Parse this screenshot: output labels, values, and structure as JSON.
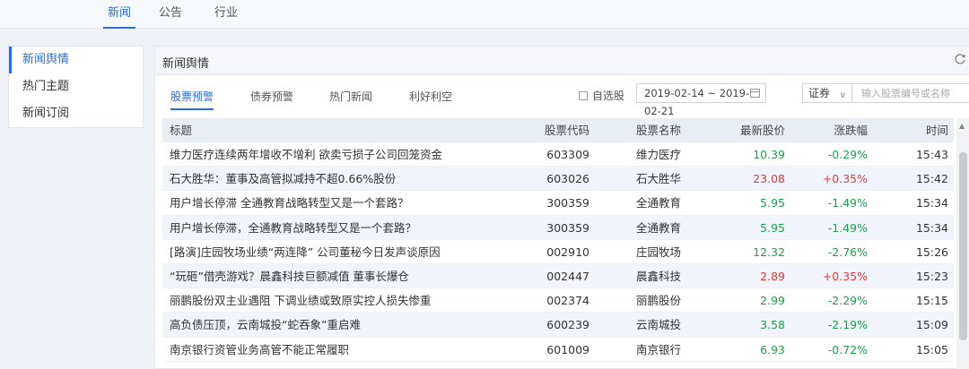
{
  "topnav": {
    "tabs": [
      {
        "label": "新闻",
        "active": true
      },
      {
        "label": "公告",
        "active": false
      },
      {
        "label": "行业",
        "active": false
      }
    ]
  },
  "sidebar": {
    "items": [
      {
        "label": "新闻舆情",
        "active": true
      },
      {
        "label": "热门主题",
        "active": false
      },
      {
        "label": "新闻订阅",
        "active": false
      }
    ]
  },
  "panel": {
    "title": "新闻舆情",
    "refresh_icon": "refresh-icon",
    "subtabs": [
      {
        "label": "股票预警",
        "active": true
      },
      {
        "label": "债券预警",
        "active": false
      },
      {
        "label": "热门新闻",
        "active": false
      },
      {
        "label": "利好利空",
        "active": false
      }
    ],
    "filters": {
      "watchlist_label": "自选股",
      "date_range": "2019-02-14 ~ 2019-02-21",
      "type_value": "证券",
      "code_placeholder": "输入股票编号或名称"
    }
  },
  "table": {
    "headers": {
      "title": "标题",
      "code": "股票代码",
      "name": "股票名称",
      "price": "最新股价",
      "change": "涨跌幅",
      "time": "时间"
    },
    "rows": [
      {
        "title": "维力医疗连续两年增收不增利 欲卖亏损子公司回笼资金",
        "code": "603309",
        "name": "维力医疗",
        "price": "10.39",
        "change": "-0.29%",
        "time": "15:43",
        "trend": "down"
      },
      {
        "title": "石大胜华：董事及高管拟减持不超0.66%股份",
        "code": "603026",
        "name": "石大胜华",
        "price": "23.08",
        "change": "+0.35%",
        "time": "15:42",
        "trend": "up"
      },
      {
        "title": "用户增长停滞 全通教育战略转型又是一个套路？",
        "code": "300359",
        "name": "全通教育",
        "price": "5.95",
        "change": "-1.49%",
        "time": "15:34",
        "trend": "down"
      },
      {
        "title": "用户增长停滞，全通教育战略转型又是一个套路？",
        "code": "300359",
        "name": "全通教育",
        "price": "5.95",
        "change": "-1.49%",
        "time": "15:34",
        "trend": "down"
      },
      {
        "title": "[路演]庄园牧场业绩“两连降” 公司董秘今日发声谈原因",
        "code": "002910",
        "name": "庄园牧场",
        "price": "12.32",
        "change": "-2.76%",
        "time": "15:26",
        "trend": "down"
      },
      {
        "title": "“玩砸”借壳游戏？晨鑫科技巨额减值 董事长爆仓",
        "code": "002447",
        "name": "晨鑫科技",
        "price": "2.89",
        "change": "+0.35%",
        "time": "15:23",
        "trend": "up"
      },
      {
        "title": "丽鹏股份双主业遇阻 下调业绩或致原实控人损失惨重",
        "code": "002374",
        "name": "丽鹏股份",
        "price": "2.99",
        "change": "-2.29%",
        "time": "15:15",
        "trend": "down"
      },
      {
        "title": "高负债压顶，云南城投“蛇吞象”重启难",
        "code": "600239",
        "name": "云南城投",
        "price": "3.58",
        "change": "-2.19%",
        "time": "15:09",
        "trend": "down"
      },
      {
        "title": "南京银行资管业务高管不能正常履职",
        "code": "601009",
        "name": "南京银行",
        "price": "6.93",
        "change": "-0.72%",
        "time": "15:05",
        "trend": "down"
      }
    ]
  }
}
